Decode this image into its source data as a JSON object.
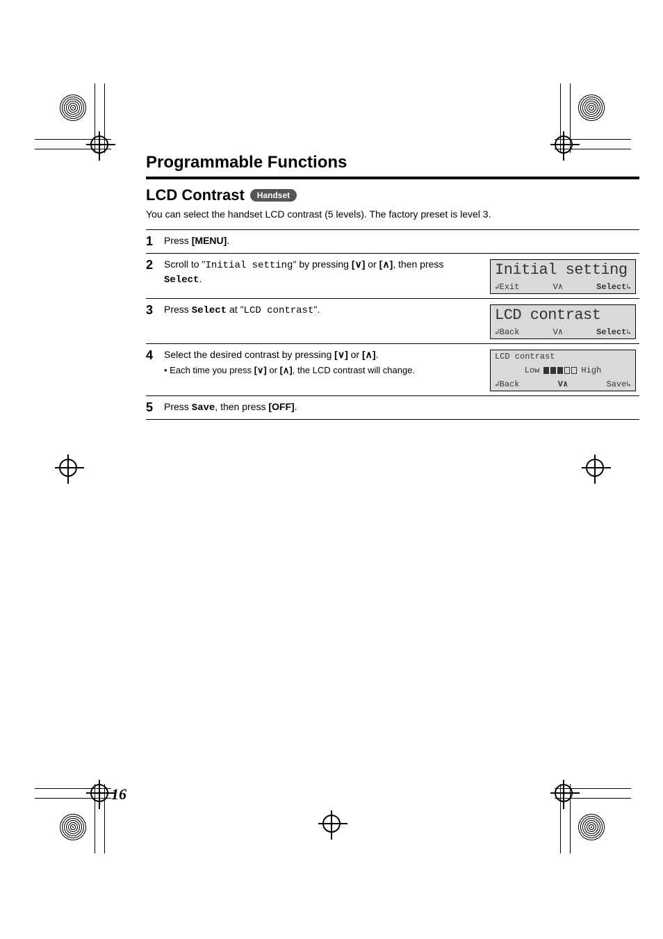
{
  "section_title": "Programmable Functions",
  "subtitle": "LCD Contrast",
  "badge": "Handset",
  "intro": "You can select the handset LCD contrast (5 levels). The factory preset is level 3.",
  "steps": {
    "s1": {
      "num": "1",
      "a": "Press ",
      "b": "[MENU]",
      "c": "."
    },
    "s2": {
      "num": "2",
      "a": "Scroll to \"",
      "m1": "Initial setting",
      "b": "\" by pressing ",
      "k1": "[",
      "k1s": "d",
      "k1e": "]",
      "c": " or ",
      "k2": "[",
      "k2s": "c",
      "k2e": "]",
      "d": ", then press ",
      "m2": "Select",
      "e": "."
    },
    "s3": {
      "num": "3",
      "a": "Press ",
      "m1": "Select",
      "b": " at \"",
      "m2": "LCD contrast",
      "c": "\"."
    },
    "s4": {
      "num": "4",
      "a": "Select the desired contrast by pressing ",
      "k1": "[",
      "k1s": "d",
      "k1e": "]",
      "b": " or ",
      "k2": "[",
      "k2s": "c",
      "k2e": "]",
      "c": ".",
      "note_a": "• Each time you press ",
      "nk1": "[",
      "nk1s": "d",
      "nk1e": "]",
      "note_b": " or ",
      "nk2": "[",
      "nk2s": "c",
      "nk2e": "]",
      "note_c": ", the LCD contrast will change."
    },
    "s5": {
      "num": "5",
      "a": "Press ",
      "m1": "Save",
      "b": ", then press ",
      "k1": "[OFF]",
      "c": "."
    }
  },
  "lcd": {
    "screen2": {
      "line1": "Initial setting",
      "left": "Exit",
      "mid": "V∧",
      "right": "Select"
    },
    "screen3": {
      "line1": "LCD contrast",
      "left": "Back",
      "mid": "V∧",
      "right": "Select"
    },
    "screen4": {
      "line1": "LCD contrast",
      "low": "Low",
      "high": "High",
      "left": "Back",
      "mid": "V∧",
      "right": "Save"
    }
  },
  "symbols": {
    "ret_left": "↲",
    "ret_right": "↳",
    "down": "∨",
    "up": "∧"
  },
  "page_number": "16"
}
